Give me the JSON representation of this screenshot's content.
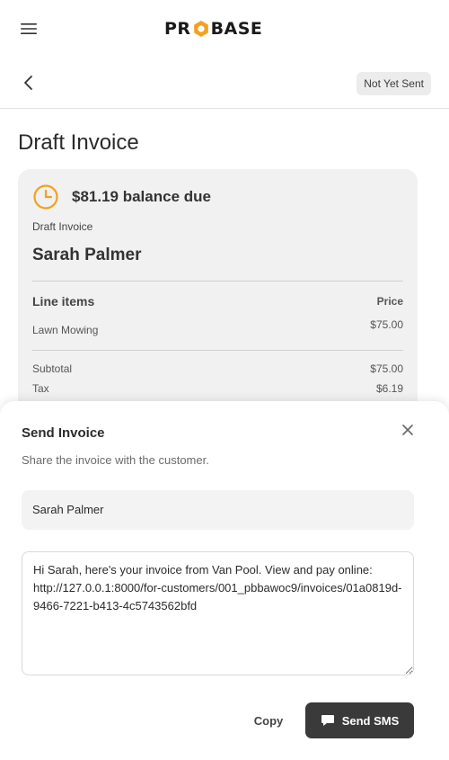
{
  "header": {
    "logo_left": "PR",
    "logo_right": "BASE",
    "menu_icon": "menu-icon",
    "logo_icon": "gear-icon",
    "brand_color": "#1a1a1a",
    "accent_color": "#f2a21e"
  },
  "subbar": {
    "back_icon": "chevron-left-icon",
    "status": "Not Yet Sent"
  },
  "page": {
    "title": "Draft Invoice"
  },
  "invoice_card": {
    "balance_icon": "clock-icon",
    "balance_text": "$81.19 balance due",
    "label": "Draft Invoice",
    "customer_name": "Sarah Palmer",
    "line_items_header": "Line items",
    "price_header": "Price",
    "line_items": [
      {
        "name": "Lawn Mowing",
        "price": "$75.00"
      }
    ],
    "totals": [
      {
        "label": "Subtotal",
        "value": "$75.00"
      },
      {
        "label": "Tax",
        "value": "$6.19"
      }
    ]
  },
  "send_sheet": {
    "title": "Send Invoice",
    "subtitle": "Share the invoice with the customer.",
    "close_icon": "close-icon",
    "recipient": "Sarah Palmer",
    "message": "Hi Sarah, here's your invoice from Van Pool. View and pay online: http://127.0.0.1:8000/for-customers/001_pbbawoc9/invoices/01a0819d-9466-7221-b413-4c5743562bfd",
    "copy_label": "Copy",
    "send_label": "Send SMS",
    "send_icon": "chat-bubble-icon",
    "send_color": "#3a3a3a"
  }
}
